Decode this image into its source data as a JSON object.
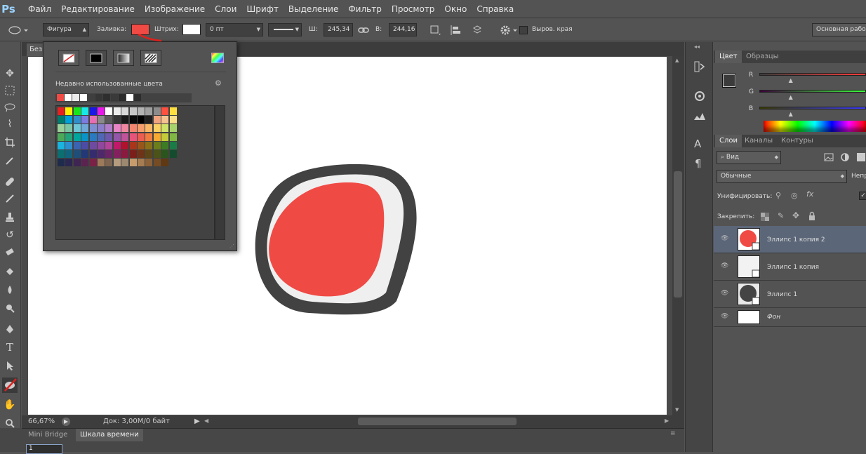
{
  "app": {
    "logo": "Ps"
  },
  "menu": [
    "Файл",
    "Редактирование",
    "Изображение",
    "Слои",
    "Шрифт",
    "Выделение",
    "Фильтр",
    "Просмотр",
    "Окно",
    "Справка"
  ],
  "options": {
    "shape_mode": "Фигура",
    "fill_label": "Заливка:",
    "fill_color": "#f04a45",
    "stroke_label": "Штрих:",
    "stroke_color": "#ffffff",
    "stroke_width": "0 пт",
    "w_label": "Ш:",
    "w_value": "245,34 п",
    "h_label": "В:",
    "h_value": "244,16 п",
    "align_edges": "Выров. края",
    "workspace": "Основная рабо"
  },
  "document": {
    "tab_title": "Без",
    "zoom": "66,67%",
    "doc_info": "Док: 3,00M/0 байт"
  },
  "bottom_tabs": {
    "mini_bridge": "Mini Bridge",
    "timeline": "Шкала времени",
    "frame": "1"
  },
  "popup": {
    "recent_title": "Недавно использованные цвета",
    "recent": [
      "#f04a45",
      "#ffffff",
      "#ebebeb",
      "#ffffff",
      "#3f3f3f",
      "#363636",
      "#2e2e2e",
      "#3a3a3a",
      "#2b2b2b",
      "#ffffff",
      "#2d2d2d"
    ],
    "swatch_rows": [
      [
        "#e62121",
        "#fff100",
        "#19e619",
        "#19e6e6",
        "#1919e6",
        "#e619e6",
        "#ffffff",
        "#ececec",
        "#d9d9d9",
        "#c6c6c6",
        "#b3b3b3",
        "#a0a0a0",
        "#8c8c8c",
        "#ff5040",
        "#ffe040"
      ],
      [
        "#007c6e",
        "#00a0d8",
        "#2e8fca",
        "#7c7ce0",
        "#e66fb3",
        "#8a8a8a",
        "#5a5a5a",
        "#363636",
        "#1a1a1a",
        "#0a0a0a",
        "#000000",
        "#1f1f1f",
        "#f2a480",
        "#f6c290",
        "#fbe08a"
      ],
      [
        "#9bd09b",
        "#7cc6a6",
        "#6fc6d6",
        "#6fa9d9",
        "#7d8fd1",
        "#8d7ec9",
        "#b27ec9",
        "#e884c7",
        "#f087a0",
        "#f2866f",
        "#f59e6c",
        "#f8b868",
        "#fbd064",
        "#d0e46a",
        "#a6d46b"
      ],
      [
        "#4ca95a",
        "#23a37a",
        "#00a59d",
        "#0a93c6",
        "#2a7ac0",
        "#4f67b4",
        "#6d58ab",
        "#9356a8",
        "#c0539a",
        "#e8537a",
        "#ec5d52",
        "#f07d3f",
        "#f5a832",
        "#c4cb3a",
        "#7fb842"
      ],
      [
        "#19b4e0",
        "#2c8fd0",
        "#3a63b1",
        "#4c4ca6",
        "#6e4aa1",
        "#90479e",
        "#b3449a",
        "#c2186a",
        "#b1122d",
        "#a9361a",
        "#98561a",
        "#8a7118",
        "#6b7e1b",
        "#3c7d24",
        "#1a7b46"
      ],
      [
        "#0b6f72",
        "#12647e",
        "#1f4f78",
        "#233877",
        "#352c70",
        "#4e286a",
        "#6b2466",
        "#84205f",
        "#8b1a3f",
        "#7b1f1a",
        "#6d3418",
        "#5c4617",
        "#4b5319",
        "#2a551d",
        "#154c2e"
      ],
      [
        "#1e2b4d",
        "#2b2750",
        "#3f2552",
        "#5a2350",
        "#7a2148",
        "#9c7a5a",
        "#7d6552",
        "#b59c7f",
        "#9d8870",
        "#c69c6d",
        "#a67c52",
        "#8b6239",
        "#754c24",
        "#603913"
      ]
    ]
  },
  "color_panel": {
    "tab_active": "Цвет",
    "tab_inactive": "Образцы",
    "channels": [
      {
        "label": "R",
        "value": 0.3
      },
      {
        "label": "G",
        "value": 0.3
      },
      {
        "label": "B",
        "value": 0.3
      }
    ]
  },
  "layers_panel": {
    "tabs": [
      "Слои",
      "Каналы",
      "Контуры"
    ],
    "filter": "Вид",
    "blend": "Обычные",
    "opacity_label": "Непр",
    "unify_label": "Унифицировать:",
    "lock_label": "Закрепить:",
    "layers": [
      {
        "name": "Эллипс 1 копия 2",
        "selected": true
      },
      {
        "name": "Эллипс 1 копия",
        "selected": false
      },
      {
        "name": "Эллипс 1",
        "selected": false
      },
      {
        "name": "Фон",
        "selected": false
      }
    ]
  },
  "colors": {
    "accent_red": "#f04a45",
    "selected_layer": "#5b6678"
  }
}
